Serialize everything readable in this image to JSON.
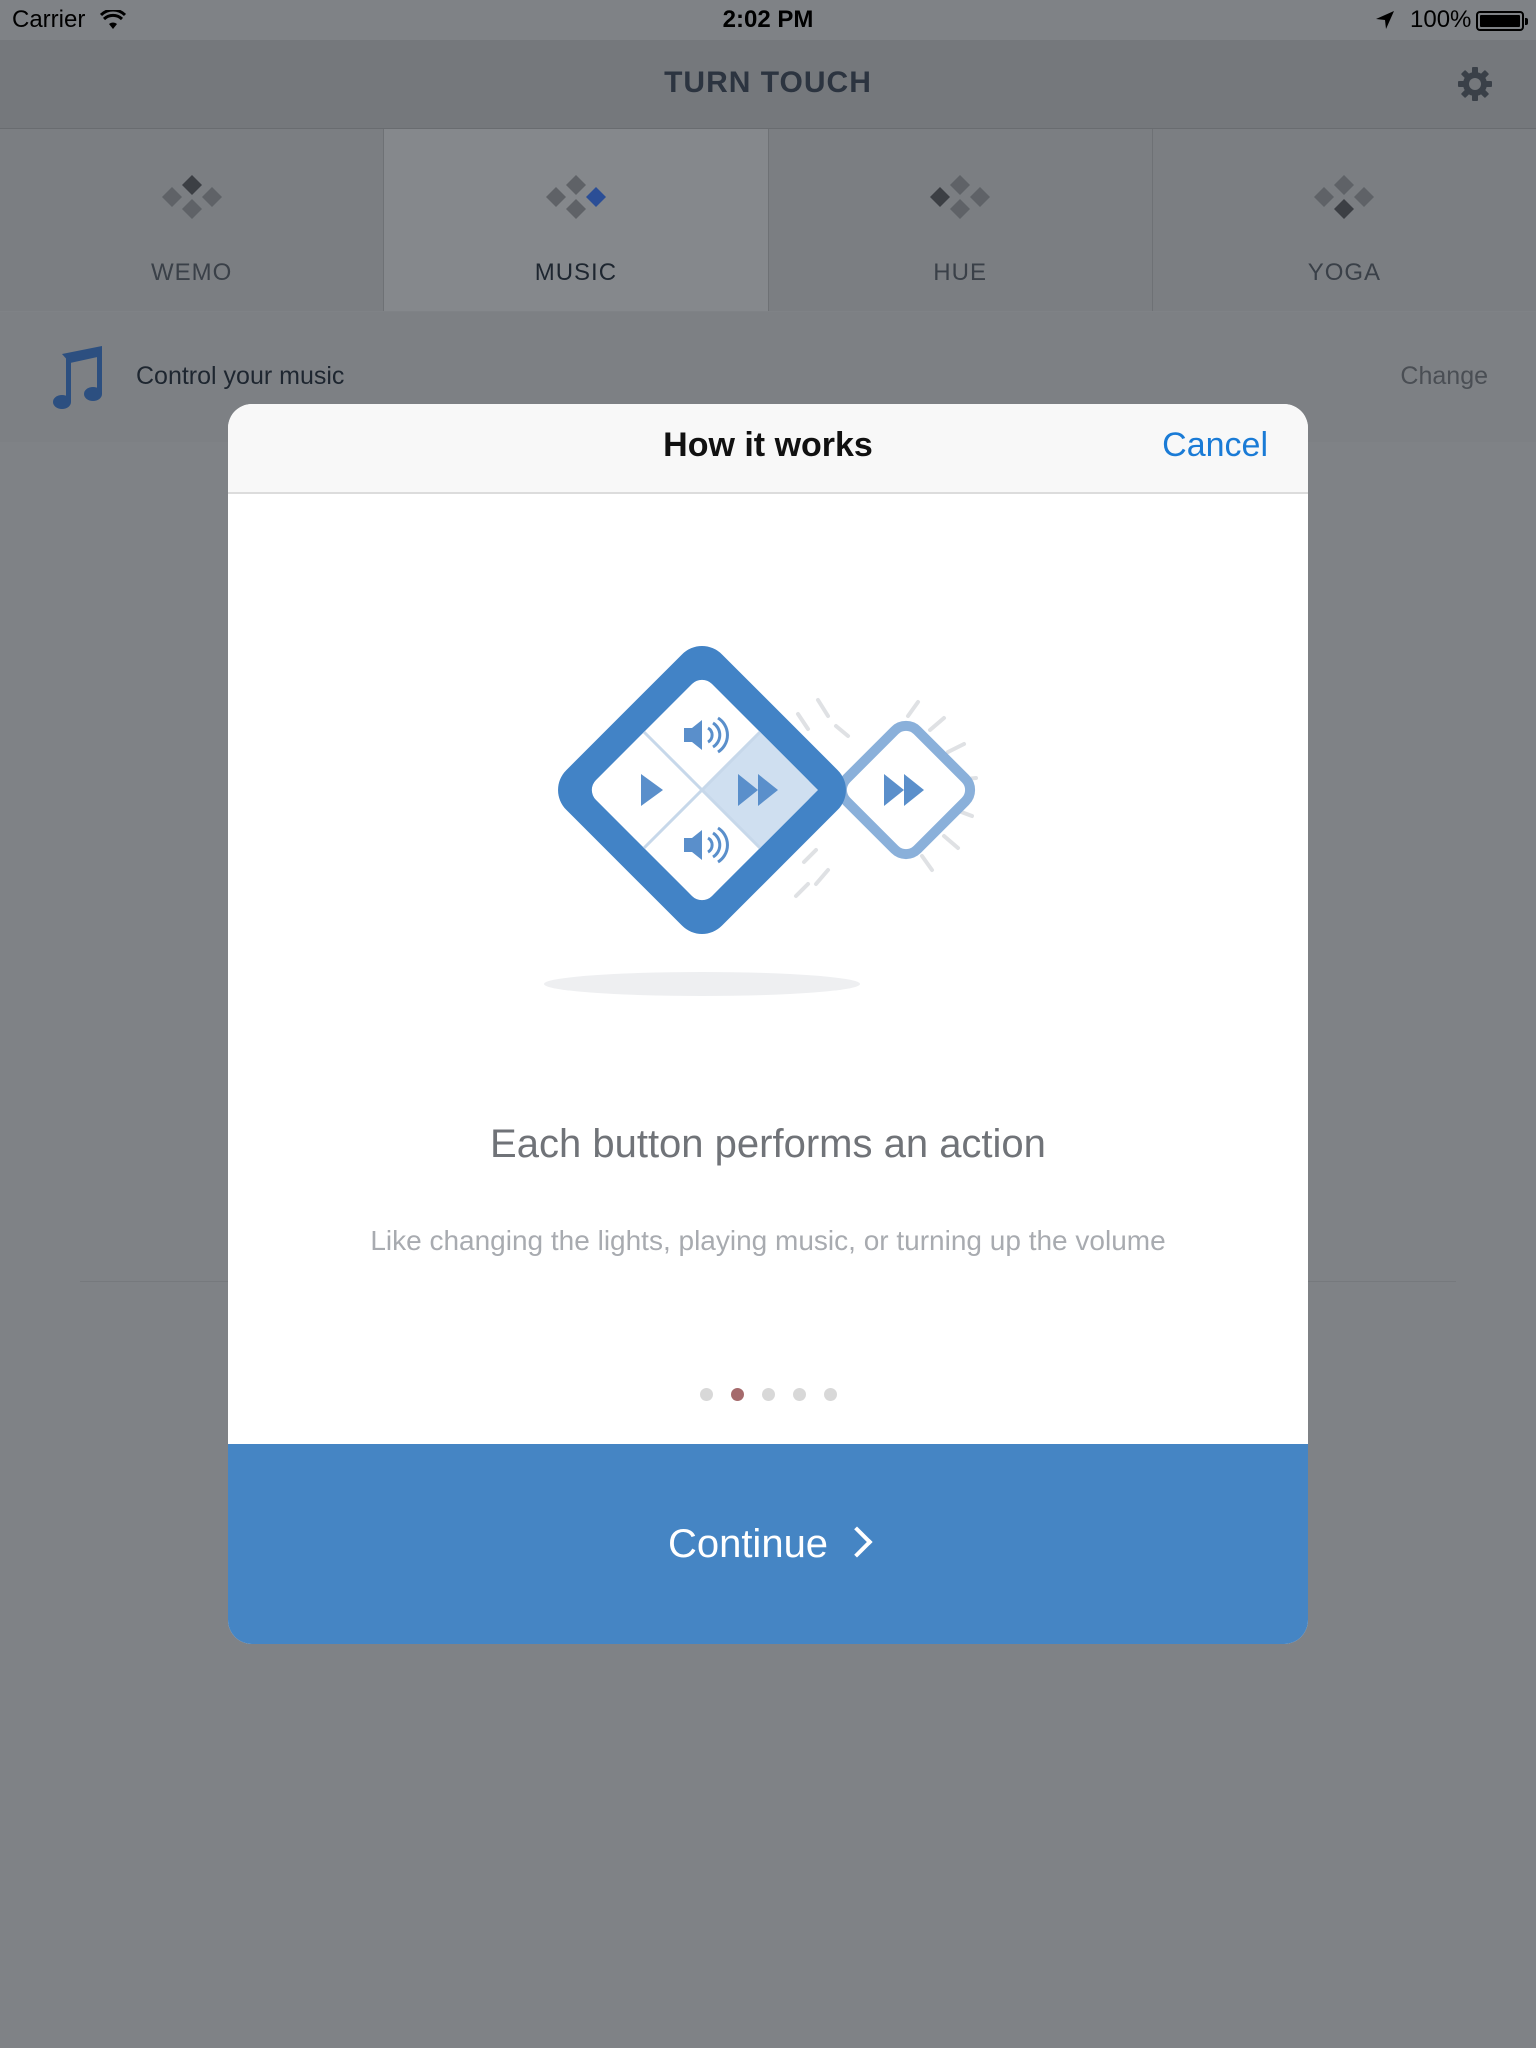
{
  "status_bar": {
    "carrier": "Carrier",
    "time": "2:02 PM",
    "battery": "100%"
  },
  "nav": {
    "title": "TURN TOUCH"
  },
  "tabs": [
    {
      "label": "WEMO",
      "active": false
    },
    {
      "label": "MUSIC",
      "active": true
    },
    {
      "label": "HUE",
      "active": false
    },
    {
      "label": "YOGA",
      "active": false
    }
  ],
  "mode_header": {
    "description": "Control your music",
    "change_label": "Change"
  },
  "modal": {
    "title": "How it works",
    "cancel_label": "Cancel",
    "heading": "Each button performs an action",
    "subtext": "Like changing the lights, playing music, or turning up the volume",
    "page_dots": {
      "count": 5,
      "active_index": 1
    },
    "continue_label": "Continue"
  },
  "colors": {
    "accent_blue": "#4585c4",
    "link_blue": "#1a7bd6",
    "active_dot": "#a56a6c",
    "overlay_gray": "#7f8286"
  },
  "icons": [
    "wifi-icon",
    "location-arrow-icon",
    "battery-icon",
    "gear-icon",
    "music-note-icon",
    "remote-diamond-icon",
    "volume-icon",
    "play-icon",
    "fast-forward-icon",
    "chevron-right-icon"
  ]
}
